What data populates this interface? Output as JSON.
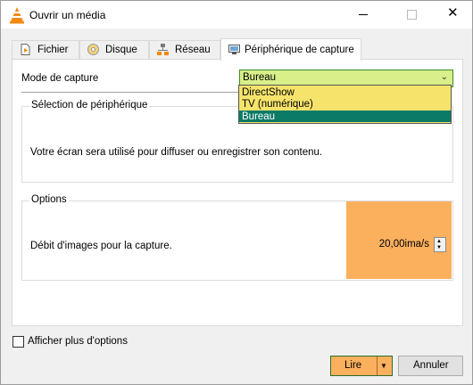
{
  "window": {
    "title": "Ouvrir un média",
    "close_glyph": "✕"
  },
  "tabs": [
    {
      "label": "Fichier",
      "icon": "file-icon"
    },
    {
      "label": "Disque",
      "icon": "disc-icon"
    },
    {
      "label": "Réseau",
      "icon": "network-icon"
    },
    {
      "label": "Périphérique de capture",
      "icon": "capture-device-icon",
      "active": true
    }
  ],
  "capture": {
    "mode_label": "Mode de capture",
    "selected": "Bureau",
    "options": [
      "DirectShow",
      "TV (numérique)",
      "Bureau"
    ]
  },
  "device_group": {
    "title": "Sélection de périphérique",
    "description": "Votre écran sera utilisé pour diffuser ou enregistrer son contenu."
  },
  "options_group": {
    "title": "Options",
    "fps_label": "Débit d'images pour la capture.",
    "fps_value": "20,00ima/s"
  },
  "footer": {
    "more_options": "Afficher plus d'options",
    "play": "Lire",
    "cancel": "Annuler"
  },
  "colors": {
    "accent_orange": "#fbb05e",
    "combo_green": "#d8ef8a",
    "dropdown_yellow": "#f5e36b",
    "selected_teal": "#0b7a66"
  }
}
